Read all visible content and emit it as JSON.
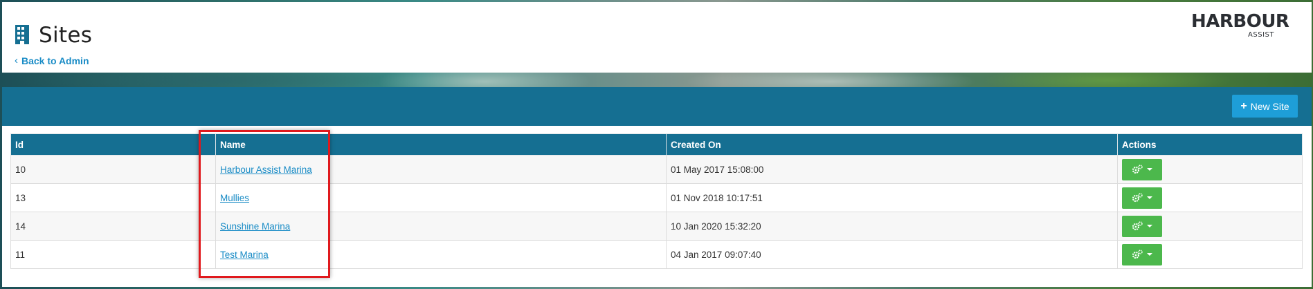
{
  "header": {
    "title": "Sites",
    "back_link": "Back to Admin",
    "logo_main": "HARBOUR",
    "logo_sub": "ASSIST"
  },
  "toolbar": {
    "new_site_label": "New Site"
  },
  "table": {
    "columns": [
      "Id",
      "Name",
      "Created On",
      "Actions"
    ],
    "rows": [
      {
        "id": "10",
        "name": "Harbour Assist Marina",
        "created_on": "01 May 2017 15:08:00"
      },
      {
        "id": "13",
        "name": "Mullies",
        "created_on": "01 Nov 2018 10:17:51"
      },
      {
        "id": "14",
        "name": "Sunshine Marina",
        "created_on": "10 Jan 2020 15:32:20"
      },
      {
        "id": "11",
        "name": "Test Marina",
        "created_on": "04 Jan 2017 09:07:40"
      }
    ]
  },
  "colors": {
    "primary": "#156f92",
    "accent": "#1e9ed8",
    "link": "#1a8cc6",
    "action_green": "#4cb84c",
    "highlight_red": "#e0191d"
  },
  "icons": {
    "title_icon": "building-icon",
    "action_icon": "gears-icon"
  }
}
